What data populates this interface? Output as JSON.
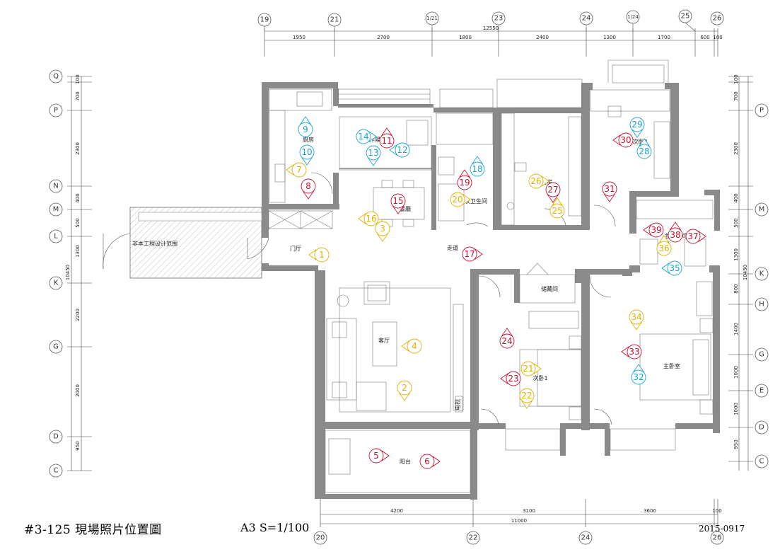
{
  "title": "#3-125 現場照片位置圖",
  "scale": "A3 S=1/100",
  "date": "2015-0917",
  "grid_top": [
    "19",
    "21",
    "1/21",
    "23",
    "24",
    "1/24",
    "25",
    "26"
  ],
  "grid_bottom": [
    "20",
    "22",
    "24",
    "26"
  ],
  "grid_rows": [
    "Q",
    "P",
    "N",
    "M",
    "L",
    "K",
    "H",
    "G",
    "E",
    "D",
    "C"
  ],
  "dims_top": [
    "1950",
    "2700",
    "1800",
    "2400",
    "1300",
    "1700",
    "600",
    "100"
  ],
  "dim_top_total": "12550",
  "dims_bottom": [
    "4200",
    "3100",
    "3600",
    "100"
  ],
  "dim_bottom_total": "11000",
  "dims_left": [
    "100",
    "700",
    "2300",
    "400",
    "500",
    "1300",
    "2200",
    "2000",
    "950"
  ],
  "dim_left_total": "10450",
  "dims_right": [
    "100",
    "700",
    "2300",
    "400",
    "500",
    "1300",
    "800",
    "1400",
    "1000",
    "1000",
    "950"
  ],
  "dim_right_total": "10450",
  "rooms": {
    "kitchen": "廚房",
    "service_balcony": "工作陽台",
    "dining": "餐廳",
    "study": "書房",
    "bedroom2": "次卧2",
    "guest_bath": "次卫生间",
    "foyer": "门厅",
    "corridor": "走道",
    "living": "客厅",
    "storage": "储藏间",
    "bedroom1": "次卧1",
    "master": "主卧室",
    "master_bath": "主卫生间",
    "balcony": "阳台",
    "outside": "非本工程设计范围",
    "tv": "电视"
  },
  "colors": {
    "red": "#c8102e",
    "yellow": "#e0b000",
    "cyan": "#1aa3d4",
    "wall": "#8a8a8a"
  },
  "markers": [
    {
      "n": "1",
      "c": "yellow",
      "dir": "left"
    },
    {
      "n": "2",
      "c": "yellow",
      "dir": "down"
    },
    {
      "n": "3",
      "c": "yellow",
      "dir": "down"
    },
    {
      "n": "4",
      "c": "yellow",
      "dir": "left"
    },
    {
      "n": "5",
      "c": "red",
      "dir": "right"
    },
    {
      "n": "6",
      "c": "red",
      "dir": "right"
    },
    {
      "n": "7",
      "c": "yellow",
      "dir": "left"
    },
    {
      "n": "8",
      "c": "red",
      "dir": "down"
    },
    {
      "n": "9",
      "c": "cyan",
      "dir": "up"
    },
    {
      "n": "10",
      "c": "cyan",
      "dir": "down"
    },
    {
      "n": "11",
      "c": "red",
      "dir": "up"
    },
    {
      "n": "12",
      "c": "cyan",
      "dir": "left"
    },
    {
      "n": "13",
      "c": "cyan",
      "dir": "down"
    },
    {
      "n": "14",
      "c": "cyan",
      "dir": "right"
    },
    {
      "n": "15",
      "c": "red",
      "dir": "down"
    },
    {
      "n": "16",
      "c": "yellow",
      "dir": "left"
    },
    {
      "n": "17",
      "c": "red",
      "dir": "right"
    },
    {
      "n": "18",
      "c": "cyan",
      "dir": "up"
    },
    {
      "n": "19",
      "c": "red",
      "dir": "up"
    },
    {
      "n": "20",
      "c": "yellow",
      "dir": "right"
    },
    {
      "n": "21",
      "c": "yellow",
      "dir": "right"
    },
    {
      "n": "22",
      "c": "yellow",
      "dir": "down"
    },
    {
      "n": "23",
      "c": "red",
      "dir": "left"
    },
    {
      "n": "24",
      "c": "red",
      "dir": "up"
    },
    {
      "n": "25",
      "c": "yellow",
      "dir": "up"
    },
    {
      "n": "26",
      "c": "yellow",
      "dir": "right"
    },
    {
      "n": "27",
      "c": "red",
      "dir": "down"
    },
    {
      "n": "28",
      "c": "cyan",
      "dir": "up"
    },
    {
      "n": "29",
      "c": "cyan",
      "dir": "down"
    },
    {
      "n": "30",
      "c": "red",
      "dir": "left"
    },
    {
      "n": "31",
      "c": "red",
      "dir": "down"
    },
    {
      "n": "32",
      "c": "cyan",
      "dir": "up"
    },
    {
      "n": "33",
      "c": "red",
      "dir": "left"
    },
    {
      "n": "34",
      "c": "yellow",
      "dir": "down"
    },
    {
      "n": "35",
      "c": "cyan",
      "dir": "left"
    },
    {
      "n": "36",
      "c": "yellow",
      "dir": "up"
    },
    {
      "n": "37",
      "c": "red",
      "dir": "right"
    },
    {
      "n": "38",
      "c": "red",
      "dir": "up"
    },
    {
      "n": "39",
      "c": "red",
      "dir": "left"
    }
  ]
}
